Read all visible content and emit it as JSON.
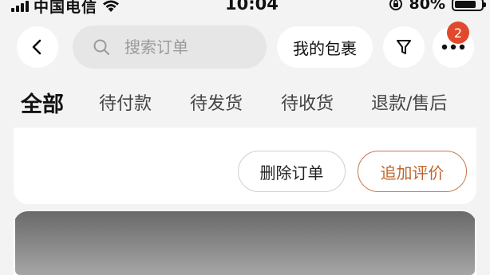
{
  "status_bar": {
    "carrier": "中国电信",
    "time": "10:04",
    "battery": "80%",
    "battery_level": 0.8
  },
  "nav": {
    "search_placeholder": "搜索订单",
    "my_packages_label": "我的包裹",
    "more_badge": "2"
  },
  "tabs": [
    {
      "label": "全部",
      "active": true
    },
    {
      "label": "待付款",
      "active": false
    },
    {
      "label": "待发货",
      "active": false
    },
    {
      "label": "待收货",
      "active": false
    },
    {
      "label": "退款/售后",
      "active": false
    }
  ],
  "order_card": {
    "delete_label": "删除订单",
    "review_label": "追加评价"
  },
  "colors": {
    "accent": "#c0642e",
    "badge": "#e0492b",
    "background": "#f3f3f3"
  }
}
